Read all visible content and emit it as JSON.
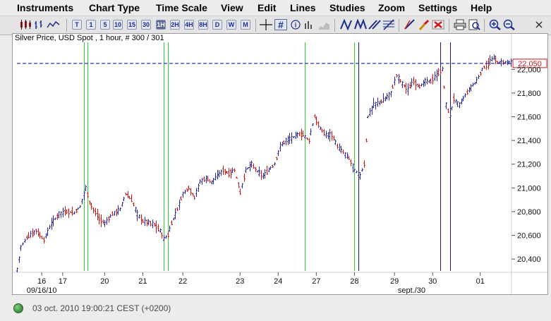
{
  "menu": [
    "Instruments",
    "Chart Type",
    "Time Scale",
    "View",
    "Edit",
    "Lines",
    "Studies",
    "Zoom",
    "Settings",
    "Help"
  ],
  "toolbar": {
    "chart_types": [
      "candles-icon",
      "bars-icon",
      "line-chart-icon"
    ],
    "timeframes": [
      "T",
      "1",
      "5",
      "10",
      "15",
      "30",
      "1H",
      "2H",
      "4H",
      "8H",
      "D",
      "W",
      "M"
    ],
    "selected_timeframe": "1H",
    "tools": [
      "crosshair-icon",
      "grid-icon",
      "info-icon",
      "volume-icon"
    ],
    "line_tools": [
      "trendline-icon",
      "zigzag-icon",
      "channel-icon",
      "fibonacci-icon"
    ],
    "edit_tools": [
      "draw-icon",
      "eraser-icon",
      "delete-icon"
    ],
    "output_tools": [
      "print-icon",
      "preview-icon"
    ],
    "zoom_tools": [
      "zoom-in-icon",
      "zoom-out-icon"
    ],
    "close_tool": "close-icon"
  },
  "chart": {
    "title": "Silver Price, USD Spot , 1 hour, # 300 / 301",
    "price_label": "22,050",
    "colors": {
      "up_bar": "#2b2ba8",
      "down_bar": "#d01818",
      "vertical_marker_green": "#33cc33",
      "vertical_marker_navy": "#1a1a7a",
      "price_line": "#0000cc",
      "price_label_border": "#d01818"
    }
  },
  "chart_data": {
    "type": "bar",
    "x_tick_labels": [
      "16",
      "17",
      "20",
      "21",
      "22",
      "23",
      "24",
      "27",
      "28",
      "29",
      "30",
      "01"
    ],
    "x_sub_labels": [
      "09/16/10",
      "sept./30"
    ],
    "y_tick_labels": [
      "22,000",
      "21,800",
      "21,600",
      "21,400",
      "21,200",
      "21,000",
      "20,800",
      "20,600",
      "20,400"
    ],
    "ylim": [
      20300,
      22180
    ],
    "current_price": 22050,
    "price_path": [
      [
        0,
        20310
      ],
      [
        2,
        20500
      ],
      [
        5,
        20580
      ],
      [
        10,
        20640
      ],
      [
        14,
        20560
      ],
      [
        18,
        20700
      ],
      [
        22,
        20780
      ],
      [
        26,
        20800
      ],
      [
        30,
        20790
      ],
      [
        33,
        20840
      ],
      [
        36,
        21000
      ],
      [
        38,
        20880
      ],
      [
        40,
        20820
      ],
      [
        43,
        20740
      ],
      [
        46,
        20700
      ],
      [
        50,
        20780
      ],
      [
        54,
        20820
      ],
      [
        57,
        20950
      ],
      [
        60,
        20900
      ],
      [
        63,
        20780
      ],
      [
        66,
        20720
      ],
      [
        69,
        20710
      ],
      [
        72,
        20690
      ],
      [
        75,
        20640
      ],
      [
        77,
        20570
      ],
      [
        79,
        20600
      ],
      [
        81,
        20700
      ],
      [
        84,
        20820
      ],
      [
        87,
        20950
      ],
      [
        90,
        21000
      ],
      [
        93,
        20920
      ],
      [
        96,
        21050
      ],
      [
        99,
        21080
      ],
      [
        102,
        21050
      ],
      [
        105,
        21100
      ],
      [
        108,
        21150
      ],
      [
        111,
        21120
      ],
      [
        114,
        21150
      ],
      [
        117,
        20960
      ],
      [
        120,
        21150
      ],
      [
        123,
        21200
      ],
      [
        126,
        21140
      ],
      [
        129,
        21100
      ],
      [
        132,
        21150
      ],
      [
        135,
        21200
      ],
      [
        138,
        21350
      ],
      [
        141,
        21400
      ],
      [
        144,
        21420
      ],
      [
        147,
        21450
      ],
      [
        150,
        21450
      ],
      [
        153,
        21400
      ],
      [
        156,
        21600
      ],
      [
        159,
        21500
      ],
      [
        162,
        21450
      ],
      [
        165,
        21450
      ],
      [
        168,
        21350
      ],
      [
        171,
        21300
      ],
      [
        174,
        21250
      ],
      [
        177,
        21150
      ],
      [
        180,
        21100
      ],
      [
        182,
        21200
      ],
      [
        184,
        21600
      ],
      [
        187,
        21700
      ],
      [
        190,
        21720
      ],
      [
        193,
        21750
      ],
      [
        196,
        21800
      ],
      [
        199,
        21950
      ],
      [
        202,
        21880
      ],
      [
        205,
        21830
      ],
      [
        208,
        21900
      ],
      [
        211,
        21850
      ],
      [
        214,
        21900
      ],
      [
        217,
        21900
      ],
      [
        220,
        21950
      ],
      [
        223,
        22000
      ],
      [
        225,
        21700
      ],
      [
        227,
        21600
      ],
      [
        229,
        21750
      ],
      [
        232,
        21700
      ],
      [
        235,
        21780
      ],
      [
        238,
        21850
      ],
      [
        241,
        21900
      ],
      [
        244,
        22000
      ],
      [
        247,
        22050
      ],
      [
        250,
        22100
      ],
      [
        252,
        22060
      ]
    ],
    "vertical_markers": [
      {
        "bar": 35,
        "color": "green"
      },
      {
        "bar": 37,
        "color": "green"
      },
      {
        "bar": 77,
        "color": "green"
      },
      {
        "bar": 79,
        "color": "green"
      },
      {
        "bar": 151,
        "color": "green"
      },
      {
        "bar": 177,
        "color": "green"
      },
      {
        "bar": 179,
        "color": "navy"
      },
      {
        "bar": 222,
        "color": "navy"
      },
      {
        "bar": 227,
        "color": "navy"
      }
    ]
  },
  "status": {
    "text": "03 oct. 2010 19:00:21  CEST (+0200)"
  }
}
